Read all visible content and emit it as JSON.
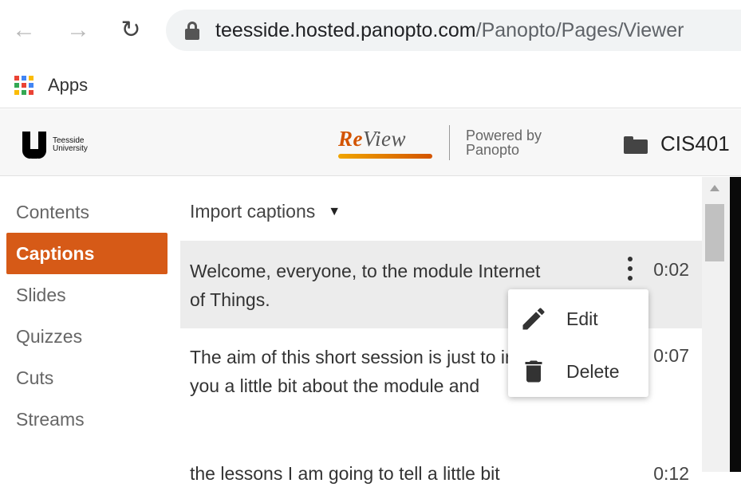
{
  "browser": {
    "url_host": "teesside.hosted.panopto.com",
    "url_path": "/Panopto/Pages/Viewer",
    "bookmarks": {
      "apps_label": "Apps"
    }
  },
  "header": {
    "uni_line1": "Teesside",
    "uni_line2": "University",
    "review_re": "Re",
    "review_view": "View",
    "powered_line1": "Powered by",
    "powered_line2": "Panopto",
    "course_title": "CIS401"
  },
  "sidebar": {
    "items": [
      {
        "label": "Contents",
        "active": false
      },
      {
        "label": "Captions",
        "active": true
      },
      {
        "label": "Slides",
        "active": false
      },
      {
        "label": "Quizzes",
        "active": false
      },
      {
        "label": "Cuts",
        "active": false
      },
      {
        "label": "Streams",
        "active": false
      }
    ]
  },
  "captions": {
    "import_label": "Import captions",
    "items": [
      {
        "text": "Welcome, everyone, to the module Internet of Things.",
        "time": "0:02"
      },
      {
        "text": "The aim of this short session is just to introduce you a little bit about the module and",
        "time": "0:07"
      },
      {
        "text": "the lessons I am going to tell a little bit",
        "time": "0:12"
      }
    ]
  },
  "context_menu": {
    "edit_label": "Edit",
    "delete_label": "Delete"
  },
  "colors": {
    "accent": "#d65a17",
    "review_orange": "#d35400"
  }
}
